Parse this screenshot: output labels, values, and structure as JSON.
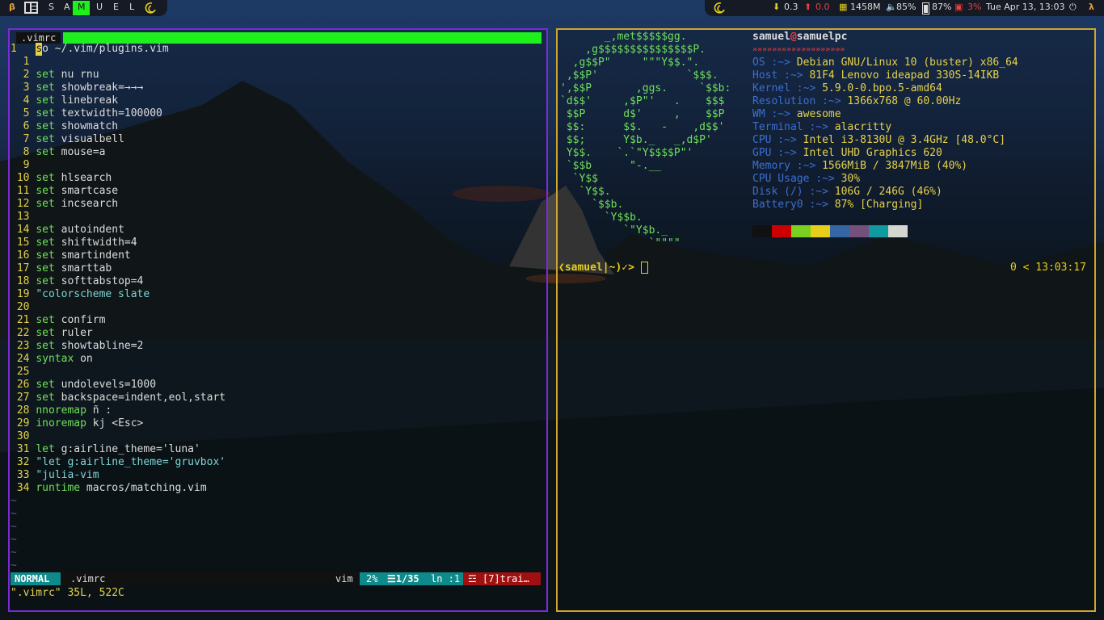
{
  "topbar": {
    "beta_icon": "β",
    "layout_icon": "tile-layout-icon",
    "tags": [
      "S",
      "A",
      "M",
      "U",
      "E",
      "L"
    ],
    "active_tag": "M",
    "debian_icon": "debian-swirl-icon",
    "load_value": "0.3",
    "upload_value": "0.0",
    "memory_value": "1458M",
    "volume_value": "85%",
    "battery_value": "87%",
    "cpu_value": "3%",
    "clock": "Tue Apr 13, 13:03",
    "power_icon": "power-icon",
    "lambda_icon": "λ"
  },
  "vim": {
    "tab_label": ".vimrc",
    "first_line_num": "1",
    "first_line_cursor": "s",
    "first_line_rest": "o ~/.vim/plugins.vim",
    "lines": [
      {
        "n": "1",
        "kw": "",
        "rest": ""
      },
      {
        "n": "2",
        "kw": "set",
        "rest": " nu rnu"
      },
      {
        "n": "3",
        "kw": "set",
        "rest": " showbreak=→→→"
      },
      {
        "n": "4",
        "kw": "set",
        "rest": " linebreak"
      },
      {
        "n": "5",
        "kw": "set",
        "rest": " textwidth=100000"
      },
      {
        "n": "6",
        "kw": "set",
        "rest": " showmatch"
      },
      {
        "n": "7",
        "kw": "set",
        "rest": " visualbell"
      },
      {
        "n": "8",
        "kw": "set",
        "rest": " mouse=a"
      },
      {
        "n": "9",
        "kw": "",
        "rest": ""
      },
      {
        "n": "10",
        "kw": "set",
        "rest": " hlsearch"
      },
      {
        "n": "11",
        "kw": "set",
        "rest": " smartcase"
      },
      {
        "n": "12",
        "kw": "set",
        "rest": " incsearch"
      },
      {
        "n": "13",
        "kw": "",
        "rest": ""
      },
      {
        "n": "14",
        "kw": "set",
        "rest": " autoindent"
      },
      {
        "n": "15",
        "kw": "set",
        "rest": " shiftwidth=4"
      },
      {
        "n": "16",
        "kw": "set",
        "rest": " smartindent"
      },
      {
        "n": "17",
        "kw": "set",
        "rest": " smarttab"
      },
      {
        "n": "18",
        "kw": "set",
        "rest": " softtabstop=4"
      },
      {
        "n": "19",
        "kw": "",
        "rest": "\"colorscheme slate"
      },
      {
        "n": "20",
        "kw": "",
        "rest": ""
      },
      {
        "n": "21",
        "kw": "set",
        "rest": " confirm"
      },
      {
        "n": "22",
        "kw": "set",
        "rest": " ruler"
      },
      {
        "n": "23",
        "kw": "set",
        "rest": " showtabline=2"
      },
      {
        "n": "24",
        "kw": "syntax",
        "rest": " on"
      },
      {
        "n": "25",
        "kw": "",
        "rest": ""
      },
      {
        "n": "26",
        "kw": "set",
        "rest": " undolevels=1000"
      },
      {
        "n": "27",
        "kw": "set",
        "rest": " backspace=indent,eol,start"
      },
      {
        "n": "28",
        "kw": "nnoremap",
        "rest": " ñ :"
      },
      {
        "n": "29",
        "kw": "inoremap",
        "rest": " kj <Esc>"
      },
      {
        "n": "30",
        "kw": "",
        "rest": ""
      },
      {
        "n": "31",
        "kw": "let",
        "rest": " g:airline_theme='luna'"
      },
      {
        "n": "32",
        "kw": "",
        "rest": "\"let g:airline_theme='gruvbox'"
      },
      {
        "n": "33",
        "kw": "",
        "rest": "\"julia-vim"
      },
      {
        "n": "34",
        "kw": "runtime",
        "rest": " macros/matching.vim"
      }
    ],
    "tildes": [
      "~",
      "~",
      "~",
      "~",
      "~",
      "~"
    ],
    "status": {
      "mode": "NORMAL",
      "file": ".vimrc",
      "filetype": "vim",
      "percent": "2%",
      "position": "☰1/35",
      "column": "ln :1",
      "warning": "☲ [7]trai…"
    },
    "cmdline": "\".vimrc\" 35L, 522C"
  },
  "terminal": {
    "user": "samuel",
    "at": "@",
    "host": "samuelpc",
    "separator": "»»»»»»»»»»»»»»»»»»»",
    "ascii_logo": [
      "       _,met$$$$$gg.",
      "    ,g$$$$$$$$$$$$$$$P.",
      "  ,g$$P\"     \"\"\"Y$$.\".",
      " ,$$P'              `$$$.",
      "',$$P       ,ggs.     `$$b:",
      "`d$$'     ,$P\"'   .    $$$",
      " $$P      d$'     ,    $$P",
      " $$:      $$.   -    ,d$$'",
      " $$;      Y$b._   _,d$P'",
      " Y$$.    `.`\"Y$$$$P\"'",
      " `$$b      \"-.__",
      "  `Y$$",
      "   `Y$$.",
      "     `$$b.",
      "       `Y$$b.",
      "          `\"Y$b._",
      "              `\"\"\"\""
    ],
    "info": [
      {
        "label": "OS",
        "value": "Debian GNU/Linux 10 (buster) x86_64"
      },
      {
        "label": "Host",
        "value": "81F4 Lenovo ideapad 330S-14IKB"
      },
      {
        "label": "Kernel",
        "value": "5.9.0-0.bpo.5-amd64"
      },
      {
        "label": "Resolution",
        "value": "1366x768 @ 60.00Hz"
      },
      {
        "label": "WM",
        "value": "awesome"
      },
      {
        "label": "Terminal",
        "value": "alacritty"
      },
      {
        "label": "CPU",
        "value": "Intel i3-8130U @ 3.4GHz [48.0°C]"
      },
      {
        "label": "GPU",
        "value": "Intel UHD Graphics 620"
      },
      {
        "label": "Memory",
        "value": "1566MiB / 3847MiB (40%)"
      },
      {
        "label": "CPU Usage",
        "value": "30%"
      },
      {
        "label": "Disk (/)",
        "value": "106G / 246G (46%)"
      },
      {
        "label": "Battery0",
        "value": "87% [Charging]"
      }
    ],
    "info_sep": " :~> ",
    "palette": [
      "#111111",
      "#cc0000",
      "#7ad01e",
      "#e6cf1a",
      "#3466a4",
      "#75507b",
      "#0f9aa0",
      "#d3d7cf"
    ],
    "prompt": "❮samuel|~)✓> ",
    "right_prompt": "0 < 13:03:17"
  }
}
